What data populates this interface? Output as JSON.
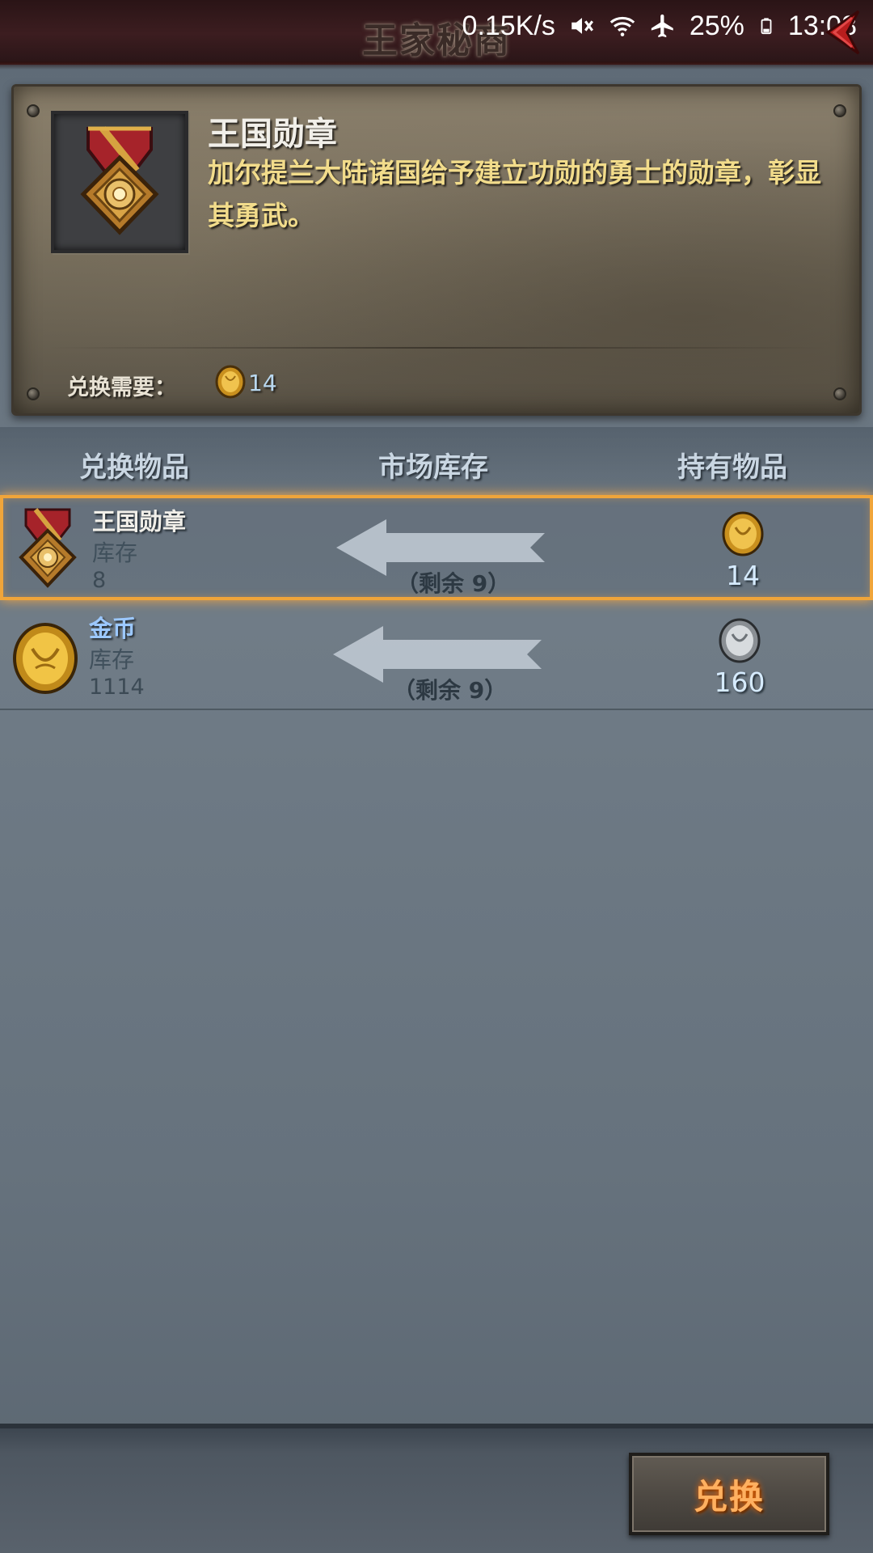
{
  "screen": {
    "title": "王家秘商"
  },
  "status_bar": {
    "network_speed": "0.15K/s",
    "battery": "25%",
    "time": "13:08"
  },
  "detail": {
    "item_name": "王国勋章",
    "description": "加尔提兰大陆诸国给予建立功勋的勇士的勋章，彰显其勇武。",
    "cost_label": "兑换需要：",
    "cost_value": "14",
    "cost_icon": "gold-medal-coin-icon"
  },
  "table": {
    "headers": [
      "兑换物品",
      "市场库存",
      "持有物品"
    ],
    "rows": [
      {
        "name": "王国勋章",
        "name_color": "#f1efe9",
        "stock_label": "库存",
        "stock_value": "8",
        "remaining": "（剩余 9）",
        "held_value": "14",
        "icon": "royal-medal-icon",
        "held_icon": "gold-coin-icon",
        "selected": true
      },
      {
        "name": "金币",
        "name_color": "#9cc8ff",
        "stock_label": "库存",
        "stock_value": "1114",
        "remaining": "（剩余 9）",
        "held_value": "160",
        "icon": "gold-coin-icon",
        "held_icon": "silver-coin-icon",
        "selected": false
      }
    ]
  },
  "actions": {
    "exchange_label": "兑换"
  },
  "colors": {
    "accent_orange": "#f0a53a",
    "button_text": "#ffb060",
    "desc_text": "#f2dc8b"
  }
}
